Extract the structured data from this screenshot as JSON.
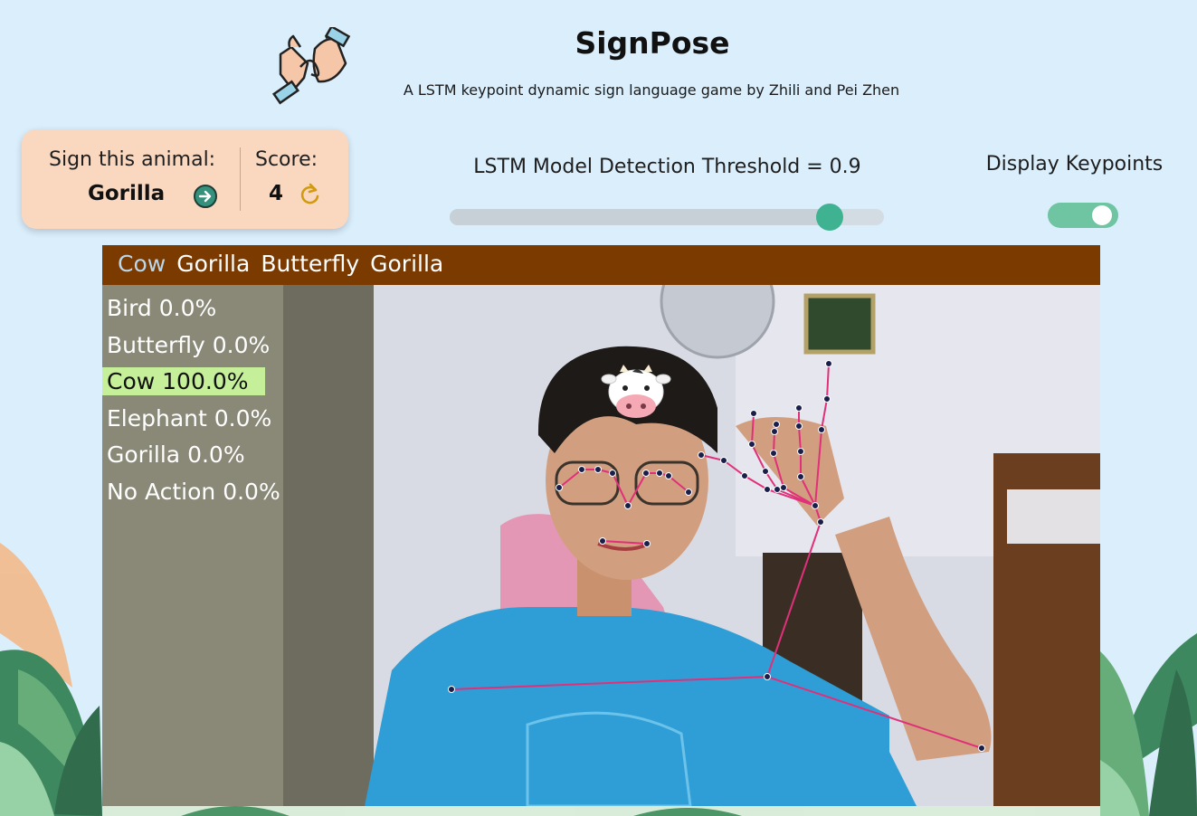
{
  "header": {
    "title": "SignPose",
    "subtitle": "A LSTM keypoint dynamic sign language game by Zhili and Pei Zhen"
  },
  "game_card": {
    "prompt_label": "Sign this animal:",
    "animal": "Gorilla",
    "score_label": "Score:",
    "score": "4"
  },
  "threshold": {
    "label": "LSTM Model Detection Threshold = 0.9",
    "value": 0.9
  },
  "keypoints_toggle": {
    "label": "Display Keypoints",
    "enabled": true
  },
  "video_feed": {
    "sequence": [
      "Cow",
      "Gorilla",
      "Butterfly",
      "Gorilla"
    ],
    "predictions": [
      {
        "label": "Bird",
        "pct": "0.0%",
        "value": 0.0
      },
      {
        "label": "Butterfly",
        "pct": "0.0%",
        "value": 0.0
      },
      {
        "label": "Cow",
        "pct": "100.0%",
        "value": 1.0
      },
      {
        "label": "Elephant",
        "pct": "0.0%",
        "value": 0.0
      },
      {
        "label": "Gorilla",
        "pct": "0.0%",
        "value": 0.0
      },
      {
        "label": "No Action",
        "pct": "0.0%",
        "value": 0.0
      }
    ]
  },
  "colors": {
    "background": "#daeefc",
    "card": "#fad8c0",
    "accent": "#3fb391",
    "sequence_bar": "#7a3a00",
    "active_prediction": "#c6ef9a",
    "keypoint_line": "#e0307a"
  },
  "icons": {
    "logo": "sign-language-hands-icon",
    "next": "arrow-right-circle-icon",
    "reset": "refresh-icon",
    "overlay": "cow-face-icon"
  }
}
